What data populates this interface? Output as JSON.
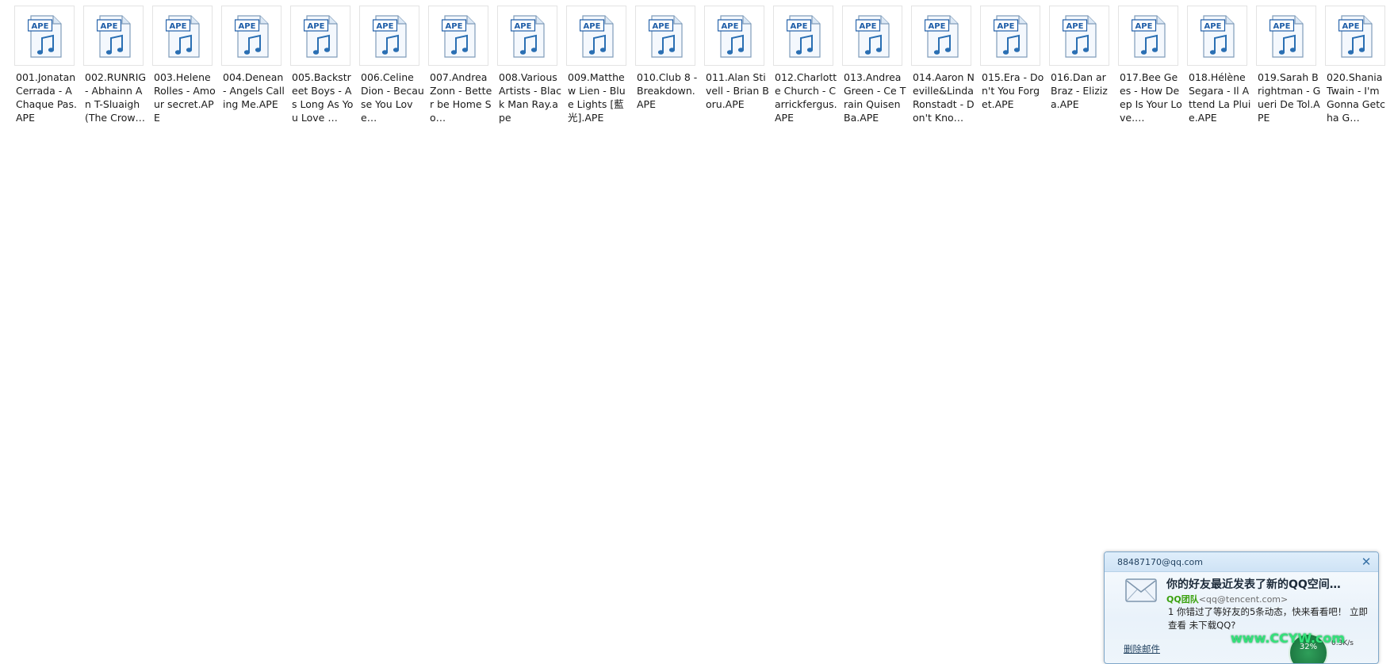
{
  "files": [
    {
      "name": "001.Jonatan Cerrada - A Chaque Pas.APE",
      "badge": "APE"
    },
    {
      "name": "002.RUNRIG - Abhainn An T-Sluaigh (The Crow…",
      "badge": "APE"
    },
    {
      "name": "003.Helene Rolles - Amour secret.APE",
      "badge": "APE"
    },
    {
      "name": "004.Denean - Angels Calling Me.APE",
      "badge": "APE"
    },
    {
      "name": "005.Backstreet Boys - As Long As You Love …",
      "badge": "APE"
    },
    {
      "name": "006.Celine Dion - Because You Love…",
      "badge": "APE"
    },
    {
      "name": "007.Andrea Zonn - Better be Home So…",
      "badge": "APE"
    },
    {
      "name": "008.Various Artists - Black Man Ray.ape",
      "badge": "APE"
    },
    {
      "name": "009.Matthew Lien - Blue Lights [藍光].APE",
      "badge": "APE"
    },
    {
      "name": "010.Club 8 - Breakdown.APE",
      "badge": "APE"
    },
    {
      "name": "011.Alan Stivell - Brian Boru.APE",
      "badge": "APE"
    },
    {
      "name": "012.Charlotte Church - Carrickfergus.APE",
      "badge": "APE"
    },
    {
      "name": "013.Andrea Green - Ce Train Quisen Ba.APE",
      "badge": "APE"
    },
    {
      "name": "014.Aaron Neville&Linda Ronstadt - Don't Kno…",
      "badge": "APE"
    },
    {
      "name": "015.Era - Don't You Forget.APE",
      "badge": "APE"
    },
    {
      "name": "016.Dan ar Braz - Eliziza.APE",
      "badge": "APE"
    },
    {
      "name": "017.Bee Gees - How Deep Is Your Love.…",
      "badge": "APE"
    },
    {
      "name": "018.Hélène Segara - Il Attend La Pluie.APE",
      "badge": "APE"
    },
    {
      "name": "019.Sarah Brightman - Gueri De Tol.APE",
      "badge": "APE"
    },
    {
      "name": "020.Shania Twain - I'm Gonna Getcha G…",
      "badge": "APE"
    }
  ],
  "notification": {
    "account": "88487170@qq.com",
    "close_icon": "close-icon",
    "subject": "你的好友最近发表了新的QQ空间…",
    "sender_name": "QQ团队",
    "sender_email": "<qq@tencent.com>",
    "body": "1 你错过了等好友的5条动态，快来看看吧！ 立即查看 未下载QQ?",
    "delete_label": "删除邮件",
    "progress_label": "32%",
    "speed_label": "0.3K/s"
  },
  "watermark": "www.CCYW.com",
  "colors": {
    "accent": "#1f5ea8",
    "icon_blue": "#2a6fb3",
    "sender_green": "#3aa10e"
  }
}
